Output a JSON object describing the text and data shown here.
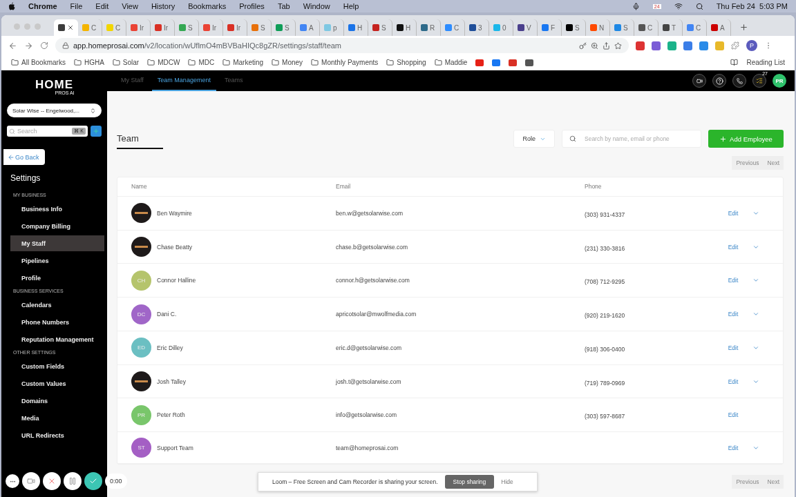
{
  "menu_bar": {
    "app": "Chrome",
    "items": [
      "File",
      "Edit",
      "View",
      "History",
      "Bookmarks",
      "Profiles",
      "Tab",
      "Window",
      "Help"
    ],
    "date": "Thu Feb 24",
    "time": "5:03 PM",
    "calendar_badge": "24"
  },
  "browser_tabs": [
    {
      "selected": true,
      "color": "#3c3c3c"
    },
    {
      "label": "C",
      "selected": false,
      "color": "#f4b400"
    },
    {
      "label": "C",
      "selected": false,
      "color": "#f2d600"
    },
    {
      "label": "Ir",
      "selected": false,
      "color": "#ea4335"
    },
    {
      "label": "Ir",
      "selected": false,
      "color": "#d93025"
    },
    {
      "label": "S",
      "selected": false,
      "color": "#34a853"
    },
    {
      "label": "Ir",
      "selected": false,
      "color": "#ea4335"
    },
    {
      "label": "Ir",
      "selected": false,
      "color": "#d93025"
    },
    {
      "label": "S",
      "selected": false,
      "color": "#e8710a"
    },
    {
      "label": "S",
      "selected": false,
      "color": "#0f9d58"
    },
    {
      "label": "A",
      "selected": false,
      "color": "#4285f4"
    },
    {
      "label": "p",
      "selected": false,
      "color": "#7ec8e3"
    },
    {
      "label": "H",
      "selected": false,
      "color": "#1a73e8"
    },
    {
      "label": "S",
      "selected": false,
      "color": "#c5221f"
    },
    {
      "label": "H",
      "selected": false,
      "color": "#111111"
    },
    {
      "label": "R",
      "selected": false,
      "color": "#2d6a8a"
    },
    {
      "label": "C",
      "selected": false,
      "color": "#2d8cff"
    },
    {
      "label": "3",
      "selected": false,
      "color": "#1f4e99"
    },
    {
      "label": "0",
      "selected": false,
      "color": "#1ab7ea"
    },
    {
      "label": "V",
      "selected": false,
      "color": "#4a3f8c"
    },
    {
      "label": "F",
      "selected": false,
      "color": "#1877f2"
    },
    {
      "label": "S",
      "selected": false,
      "color": "#000000"
    },
    {
      "label": "N",
      "selected": false,
      "color": "#ff4a00"
    },
    {
      "label": "S",
      "selected": false,
      "color": "#1e88e5"
    },
    {
      "label": "C",
      "selected": false,
      "color": "#555555"
    },
    {
      "label": "T",
      "selected": false,
      "color": "#444444"
    },
    {
      "label": "C",
      "selected": false,
      "color": "#4285f4"
    },
    {
      "label": "A",
      "selected": false,
      "color": "#cc0000"
    }
  ],
  "address_bar": {
    "host": "app.homeprosai.com",
    "path": "/v2/location/wUflmO4mBVBaHIQc8gZR/settings/staff/team"
  },
  "bookmarks": [
    {
      "label": "All Bookmarks",
      "kind": "folder"
    },
    {
      "label": "HGHA",
      "kind": "folder"
    },
    {
      "label": "Solar",
      "kind": "folder"
    },
    {
      "label": "MDCW",
      "kind": "folder"
    },
    {
      "label": "MDC",
      "kind": "folder"
    },
    {
      "label": "Marketing",
      "kind": "folder"
    },
    {
      "label": "Money",
      "kind": "folder"
    },
    {
      "label": "Monthly Payments",
      "kind": "folder"
    },
    {
      "label": "Shopping",
      "kind": "folder"
    },
    {
      "label": "Maddie",
      "kind": "folder"
    },
    {
      "kind": "youtube"
    },
    {
      "kind": "facebook"
    },
    {
      "kind": "gmail"
    },
    {
      "kind": "squarespace"
    }
  ],
  "profile_initial": "P",
  "reading_list": "Reading List",
  "sidebar": {
    "logo_main": "HOME",
    "logo_sub": "PROS AI",
    "location": "Solar Wise -- Engelwood,...",
    "search_placeholder": "Search",
    "shortcut": "⌘ K",
    "go_back": "Go Back",
    "title": "Settings",
    "sections": [
      {
        "heading": "MY BUSINESS",
        "items": [
          {
            "label": "Business Info",
            "selected": false
          },
          {
            "label": "Company Billing",
            "selected": false
          },
          {
            "label": "My Staff",
            "selected": true
          },
          {
            "label": "Pipelines",
            "selected": false
          },
          {
            "label": "Profile",
            "selected": false
          }
        ]
      },
      {
        "heading": "BUSINESS SERVICES",
        "items": [
          {
            "label": "Calendars",
            "selected": false
          },
          {
            "label": "Phone Numbers",
            "selected": false
          },
          {
            "label": "Reputation Management",
            "selected": false
          }
        ]
      },
      {
        "heading": "OTHER SETTINGS",
        "items": [
          {
            "label": "Custom Fields",
            "selected": false
          },
          {
            "label": "Custom Values",
            "selected": false
          },
          {
            "label": "Domains",
            "selected": false
          },
          {
            "label": "Media",
            "selected": false
          },
          {
            "label": "URL Redirects",
            "selected": false
          }
        ]
      }
    ]
  },
  "top_nav": {
    "tabs": [
      {
        "label": "My Staff",
        "selected": false
      },
      {
        "label": "Team Management",
        "selected": true
      },
      {
        "label": "Teams",
        "selected": false
      }
    ],
    "notification_count": "27",
    "user_initials": "PR"
  },
  "team": {
    "title": "Team",
    "role_filter": "Role",
    "search_placeholder": "Search by name, email or phone",
    "add_button": "Add Employee",
    "previous": "Previous",
    "next": "Next",
    "columns": [
      "Name",
      "Email",
      "Phone"
    ],
    "rows": [
      {
        "name": "Ben Waymire",
        "email": "ben.w@getsolarwise.com",
        "phone": "(303) 931-4337",
        "kind": "logo",
        "action": "Edit",
        "has_menu": true
      },
      {
        "name": "Chase Beatty",
        "email": "chase.b@getsolarwise.com",
        "phone": "(231) 330-3816",
        "kind": "logo",
        "action": "Edit",
        "has_menu": true
      },
      {
        "name": "Connor Halline",
        "email": "connor.h@getsolarwise.com",
        "phone": "(708) 712-9295",
        "kind": "initials",
        "initials": "CH",
        "color": "#b5c46c",
        "action": "Edit",
        "has_menu": true
      },
      {
        "name": "Dani C.",
        "email": "apricotsolar@mwolfmedia.com",
        "phone": "(920) 219-1620",
        "kind": "initials",
        "initials": "DC",
        "color": "#a066c8",
        "action": "Edit",
        "has_menu": true
      },
      {
        "name": "Eric Dilley",
        "email": "eric.d@getsolarwise.com",
        "phone": "(918) 306-0400",
        "kind": "initials",
        "initials": "ED",
        "color": "#6bbfc2",
        "action": "Edit",
        "has_menu": true
      },
      {
        "name": "Josh Talley",
        "email": "josh.t@getsolarwise.com",
        "phone": "(719) 789-0969",
        "kind": "logo",
        "action": "Edit",
        "has_menu": true
      },
      {
        "name": "Peter Roth",
        "email": "info@getsolarwise.com",
        "phone": "(303) 597-8687",
        "kind": "initials",
        "initials": "PR",
        "color": "#79c66b",
        "action": "Edit",
        "has_menu": false
      },
      {
        "name": "Support Team",
        "email": "team@homeprosai.com",
        "kind": "initials",
        "initials": "ST",
        "color": "#a45fc4",
        "action": "Edit",
        "has_menu": true
      }
    ],
    "bottom_previous": "Previous",
    "bottom_next": "Next"
  },
  "loom": {
    "timer": "0:00",
    "message": "Loom – Free Screen and Cam Recorder is sharing your screen.",
    "stop": "Stop sharing",
    "hide": "Hide"
  }
}
